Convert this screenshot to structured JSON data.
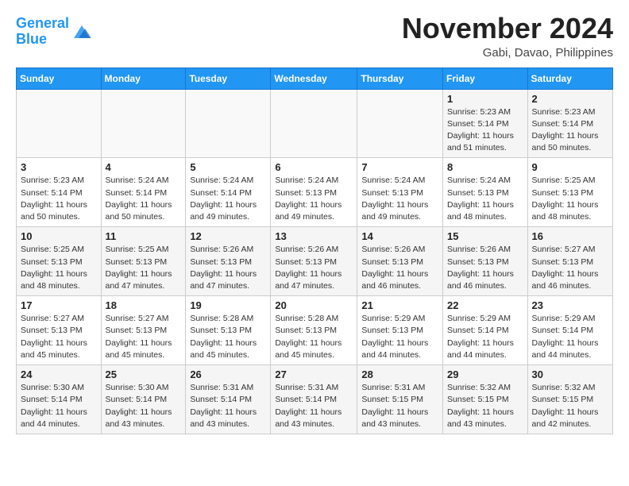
{
  "header": {
    "logo_line1": "General",
    "logo_line2": "Blue",
    "month_title": "November 2024",
    "location": "Gabi, Davao, Philippines"
  },
  "weekdays": [
    "Sunday",
    "Monday",
    "Tuesday",
    "Wednesday",
    "Thursday",
    "Friday",
    "Saturday"
  ],
  "weeks": [
    [
      {
        "day": "",
        "info": ""
      },
      {
        "day": "",
        "info": ""
      },
      {
        "day": "",
        "info": ""
      },
      {
        "day": "",
        "info": ""
      },
      {
        "day": "",
        "info": ""
      },
      {
        "day": "1",
        "info": "Sunrise: 5:23 AM\nSunset: 5:14 PM\nDaylight: 11 hours\nand 51 minutes."
      },
      {
        "day": "2",
        "info": "Sunrise: 5:23 AM\nSunset: 5:14 PM\nDaylight: 11 hours\nand 50 minutes."
      }
    ],
    [
      {
        "day": "3",
        "info": "Sunrise: 5:23 AM\nSunset: 5:14 PM\nDaylight: 11 hours\nand 50 minutes."
      },
      {
        "day": "4",
        "info": "Sunrise: 5:24 AM\nSunset: 5:14 PM\nDaylight: 11 hours\nand 50 minutes."
      },
      {
        "day": "5",
        "info": "Sunrise: 5:24 AM\nSunset: 5:14 PM\nDaylight: 11 hours\nand 49 minutes."
      },
      {
        "day": "6",
        "info": "Sunrise: 5:24 AM\nSunset: 5:13 PM\nDaylight: 11 hours\nand 49 minutes."
      },
      {
        "day": "7",
        "info": "Sunrise: 5:24 AM\nSunset: 5:13 PM\nDaylight: 11 hours\nand 49 minutes."
      },
      {
        "day": "8",
        "info": "Sunrise: 5:24 AM\nSunset: 5:13 PM\nDaylight: 11 hours\nand 48 minutes."
      },
      {
        "day": "9",
        "info": "Sunrise: 5:25 AM\nSunset: 5:13 PM\nDaylight: 11 hours\nand 48 minutes."
      }
    ],
    [
      {
        "day": "10",
        "info": "Sunrise: 5:25 AM\nSunset: 5:13 PM\nDaylight: 11 hours\nand 48 minutes."
      },
      {
        "day": "11",
        "info": "Sunrise: 5:25 AM\nSunset: 5:13 PM\nDaylight: 11 hours\nand 47 minutes."
      },
      {
        "day": "12",
        "info": "Sunrise: 5:26 AM\nSunset: 5:13 PM\nDaylight: 11 hours\nand 47 minutes."
      },
      {
        "day": "13",
        "info": "Sunrise: 5:26 AM\nSunset: 5:13 PM\nDaylight: 11 hours\nand 47 minutes."
      },
      {
        "day": "14",
        "info": "Sunrise: 5:26 AM\nSunset: 5:13 PM\nDaylight: 11 hours\nand 46 minutes."
      },
      {
        "day": "15",
        "info": "Sunrise: 5:26 AM\nSunset: 5:13 PM\nDaylight: 11 hours\nand 46 minutes."
      },
      {
        "day": "16",
        "info": "Sunrise: 5:27 AM\nSunset: 5:13 PM\nDaylight: 11 hours\nand 46 minutes."
      }
    ],
    [
      {
        "day": "17",
        "info": "Sunrise: 5:27 AM\nSunset: 5:13 PM\nDaylight: 11 hours\nand 45 minutes."
      },
      {
        "day": "18",
        "info": "Sunrise: 5:27 AM\nSunset: 5:13 PM\nDaylight: 11 hours\nand 45 minutes."
      },
      {
        "day": "19",
        "info": "Sunrise: 5:28 AM\nSunset: 5:13 PM\nDaylight: 11 hours\nand 45 minutes."
      },
      {
        "day": "20",
        "info": "Sunrise: 5:28 AM\nSunset: 5:13 PM\nDaylight: 11 hours\nand 45 minutes."
      },
      {
        "day": "21",
        "info": "Sunrise: 5:29 AM\nSunset: 5:13 PM\nDaylight: 11 hours\nand 44 minutes."
      },
      {
        "day": "22",
        "info": "Sunrise: 5:29 AM\nSunset: 5:14 PM\nDaylight: 11 hours\nand 44 minutes."
      },
      {
        "day": "23",
        "info": "Sunrise: 5:29 AM\nSunset: 5:14 PM\nDaylight: 11 hours\nand 44 minutes."
      }
    ],
    [
      {
        "day": "24",
        "info": "Sunrise: 5:30 AM\nSunset: 5:14 PM\nDaylight: 11 hours\nand 44 minutes."
      },
      {
        "day": "25",
        "info": "Sunrise: 5:30 AM\nSunset: 5:14 PM\nDaylight: 11 hours\nand 43 minutes."
      },
      {
        "day": "26",
        "info": "Sunrise: 5:31 AM\nSunset: 5:14 PM\nDaylight: 11 hours\nand 43 minutes."
      },
      {
        "day": "27",
        "info": "Sunrise: 5:31 AM\nSunset: 5:14 PM\nDaylight: 11 hours\nand 43 minutes."
      },
      {
        "day": "28",
        "info": "Sunrise: 5:31 AM\nSunset: 5:15 PM\nDaylight: 11 hours\nand 43 minutes."
      },
      {
        "day": "29",
        "info": "Sunrise: 5:32 AM\nSunset: 5:15 PM\nDaylight: 11 hours\nand 43 minutes."
      },
      {
        "day": "30",
        "info": "Sunrise: 5:32 AM\nSunset: 5:15 PM\nDaylight: 11 hours\nand 42 minutes."
      }
    ]
  ]
}
